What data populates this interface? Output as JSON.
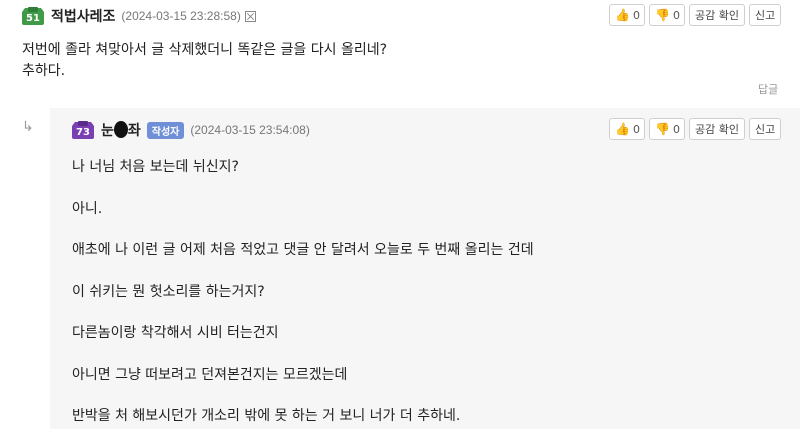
{
  "comment": {
    "level": "51",
    "level_color": "#3f9b47",
    "nickname": "적법사레조",
    "date": "(2024-03-15 23:28:58)",
    "like_count": "0",
    "dislike_count": "0",
    "check_label": "공감 확인",
    "report_label": "신고",
    "body": [
      "저번에 졸라 쳐맞아서 글 삭제했더니 똑같은 글을 다시 올리네?",
      "추하다."
    ],
    "reply_label": "답글"
  },
  "reply": {
    "arrow": "↳",
    "level": "73",
    "level_color": "#7a3fb3",
    "nickname_part1": "눈",
    "nickname_part2": "좌",
    "author_badge": "작성자",
    "date": "(2024-03-15 23:54:08)",
    "like_count": "0",
    "dislike_count": "0",
    "check_label": "공감 확인",
    "report_label": "신고",
    "lines": [
      "나 너님 처음 보는데 뉘신지?",
      "아니.",
      "애초에 나 이런 글 어제 처음 적었고 댓글 안 달려서 오늘로 두 번째 올리는 건데",
      "이 쉬키는 뭔 헛소리를 하는거지?",
      "다른놈이랑 착각해서 시비 터는건지",
      "아니면 그냥 떠보려고 던져본건지는 모르겠는데",
      "반박을 처 해보시던가 개소리 밖에 못 하는 거 보니 너가 더 추하네."
    ]
  },
  "icons": {
    "like": "thumbs-up-icon",
    "dislike": "thumbs-down-icon",
    "delete": "delete-box-icon"
  }
}
